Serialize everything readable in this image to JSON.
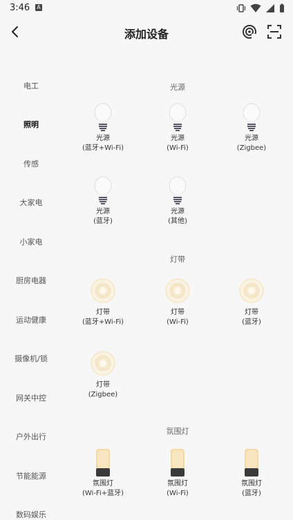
{
  "status": {
    "time": "3:46",
    "notif_letter": "A"
  },
  "header": {
    "title": "添加设备"
  },
  "sidebar": {
    "items": [
      {
        "label": "电工"
      },
      {
        "label": "照明"
      },
      {
        "label": "传感"
      },
      {
        "label": "大家电"
      },
      {
        "label": "小家电"
      },
      {
        "label": "厨房电器"
      },
      {
        "label": "运动健康"
      },
      {
        "label": "摄像机/锁"
      },
      {
        "label": "网关中控"
      },
      {
        "label": "户外出行"
      },
      {
        "label": "节能能源"
      },
      {
        "label": "数码娱乐"
      }
    ]
  },
  "sections": {
    "light_source": {
      "title": "光源",
      "devices": [
        {
          "name": "光源",
          "protocol": "(蓝牙+Wi-Fi)",
          "icon": "bulb-icon"
        },
        {
          "name": "光源",
          "protocol": "(Wi-Fi)",
          "icon": "bulb-icon"
        },
        {
          "name": "光源",
          "protocol": "(Zigbee)",
          "icon": "bulb-icon"
        },
        {
          "name": "光源",
          "protocol": "(蓝牙)",
          "icon": "bulb-icon"
        },
        {
          "name": "光源",
          "protocol": "(其他)",
          "icon": "bulb-icon"
        }
      ]
    },
    "light_strip": {
      "title": "灯带",
      "devices": [
        {
          "name": "灯带",
          "protocol": "(蓝牙+Wi-Fi)",
          "icon": "light-strip-icon"
        },
        {
          "name": "灯带",
          "protocol": "(Wi-Fi)",
          "icon": "light-strip-icon"
        },
        {
          "name": "灯带",
          "protocol": "(蓝牙)",
          "icon": "light-strip-icon"
        },
        {
          "name": "灯带",
          "protocol": "(Zigbee)",
          "icon": "light-strip-icon"
        }
      ]
    },
    "ambient": {
      "title": "氛围灯",
      "devices": [
        {
          "name": "氛围灯",
          "protocol": "(Wi-Fi+蓝牙)",
          "icon": "ambient-lamp-icon"
        },
        {
          "name": "氛围灯",
          "protocol": "(Wi-Fi)",
          "icon": "ambient-lamp-icon"
        },
        {
          "name": "氛围灯",
          "protocol": "(蓝牙)",
          "icon": "ambient-lamp-icon"
        }
      ]
    }
  },
  "colors": {
    "background": "#f7f7f7",
    "text": "#333333",
    "active": "#111111"
  }
}
